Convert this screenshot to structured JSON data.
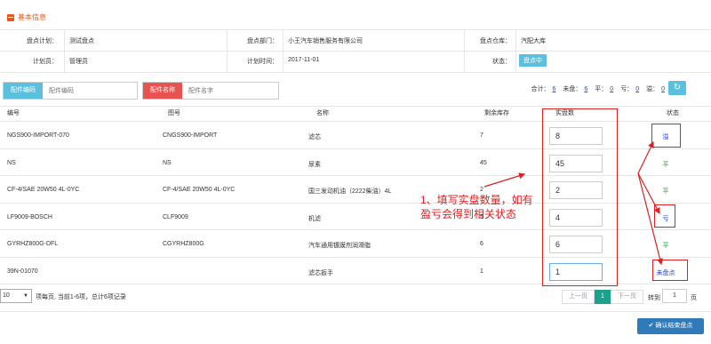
{
  "section": {
    "title": "基本信息"
  },
  "info": {
    "plan_label": "盘点计划：",
    "plan_value": "测试盘点",
    "dept_label": "盘点部门：",
    "dept_value": "小王汽车销售服务有限公司",
    "warehouse_label": "盘点仓库：",
    "warehouse_value": "汽配大库",
    "planner_label": "计划员：",
    "planner_value": "管理员",
    "time_label": "计划时间：",
    "time_value": "2017-11-01",
    "state_label": "状态：",
    "state_value": "盘点中"
  },
  "search": {
    "code_label": "配件编码",
    "code_placeholder": "配件编码",
    "name_label": "配件名称",
    "name_placeholder": "配件名字"
  },
  "totals": {
    "total_label": "合计：",
    "total": "6",
    "unchecked_label": "未盘：",
    "unchecked": "6",
    "even_label": "平：",
    "even": "0",
    "loss_label": "亏：",
    "loss": "0",
    "gain_label": "溢：",
    "gain": "0"
  },
  "table": {
    "headers": {
      "code": "编号",
      "figure": "图号",
      "name": "名称",
      "stock": "剩余库存",
      "actual": "实盘数",
      "status": "状态"
    },
    "rows": [
      {
        "code": "NGS900-IMPORT-070",
        "figure": "CNGS900-IMPORT",
        "name": "滤芯",
        "stock": "7",
        "actual": "8",
        "status": "溢",
        "status_color": "#1a3fd6"
      },
      {
        "code": "NS",
        "figure": "NS",
        "name": "尿素",
        "stock": "45",
        "actual": "45",
        "status": "平",
        "status_color": "#1a9c3a"
      },
      {
        "code": "CF-4/SAE 20W50 4L-0YC",
        "figure": "CF-4/SAE 20W50 4L-0YC",
        "name": "国三发动机油（2222柴油）4L",
        "stock": "2",
        "actual": "2",
        "status": "平",
        "status_color": "#1a9c3a"
      },
      {
        "code": "LF9009-BOSCH",
        "figure": "CLF9009",
        "name": "机滤",
        "stock": "5",
        "actual": "4",
        "status": "亏",
        "status_color": "#1a3fd6"
      },
      {
        "code": "GYRHZ800G-DFL",
        "figure": "CGYRHZ800G",
        "name": "汽车通用镀膜剂润滑脂",
        "stock": "6",
        "actual": "6",
        "status": "平",
        "status_color": "#1a9c3a"
      },
      {
        "code": "39N-01070",
        "figure": "",
        "name": "滤芯扳手",
        "stock": "1",
        "actual": "1",
        "status": "未盘点",
        "status_color": "#1a3fd6"
      }
    ]
  },
  "annotation": {
    "line1": "1、填写实盘数量，如有",
    "line2": "盈亏会得到相关状态"
  },
  "pagination": {
    "page_size": "10",
    "summary": "项每页, 当前1-6项，总计6项记录",
    "prev": "上一页",
    "current": "1",
    "next": "下一页",
    "goto_label": "转到",
    "goto_value": "1",
    "page_unit": "页"
  },
  "actions": {
    "submit": "确认结束盘点"
  },
  "colors": {
    "accent_orange": "#e5571e",
    "teal": "#5bc0de",
    "red": "#e02020",
    "blue_btn": "#2f7ab8",
    "search_code_bg": "#5bc0de",
    "search_name_bg": "#e9534f"
  }
}
